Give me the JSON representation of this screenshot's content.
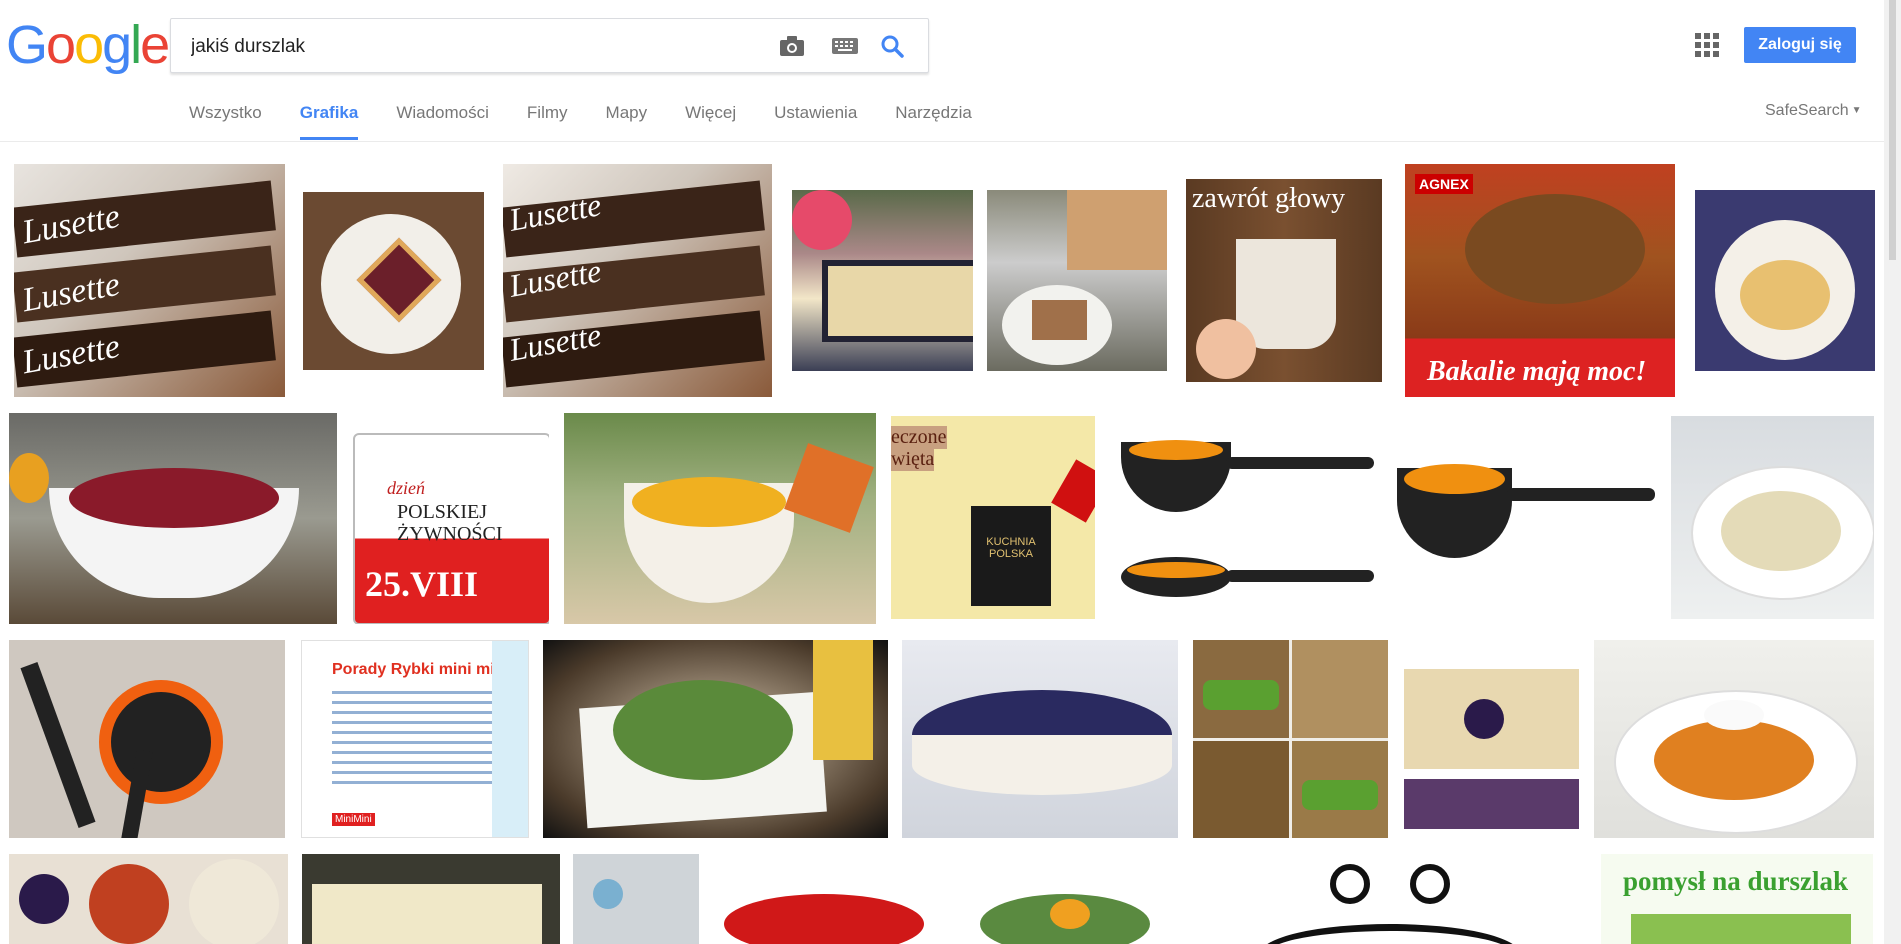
{
  "logo": [
    "G",
    "o",
    "o",
    "g",
    "l",
    "e"
  ],
  "search": {
    "value": "jakiś durszlak"
  },
  "header": {
    "login_label": "Zaloguj się"
  },
  "tabs": [
    "Wszystko",
    "Grafika",
    "Wiadomości",
    "Filmy",
    "Mapy",
    "Więcej",
    "Ustawienia",
    "Narzędzia"
  ],
  "safesearch": "SafeSearch",
  "image_texts": {
    "lusette": "Lusette",
    "zawrot": "zawrót głowy",
    "agnex": "AGNEX",
    "bakalie": "Bakalie mają moc!",
    "dzien": "dzień",
    "polskiej": "POLSKIEJ",
    "zywnosci": "ŻYWNOŚCI",
    "date": "25.VIII",
    "kuchnia": "KUCHNIA POLSKA",
    "pieczone": "eczone",
    "swieta": "więta",
    "porady": "Porady Rybki mini mini",
    "minimini": "MiniMini",
    "pomysl": "pomysł na durszlak"
  },
  "colors": {
    "accent": "#4285f4",
    "logo": [
      "#4285f4",
      "#ea4335",
      "#fbbc05",
      "#4285f4",
      "#34a853",
      "#ea4335"
    ]
  }
}
